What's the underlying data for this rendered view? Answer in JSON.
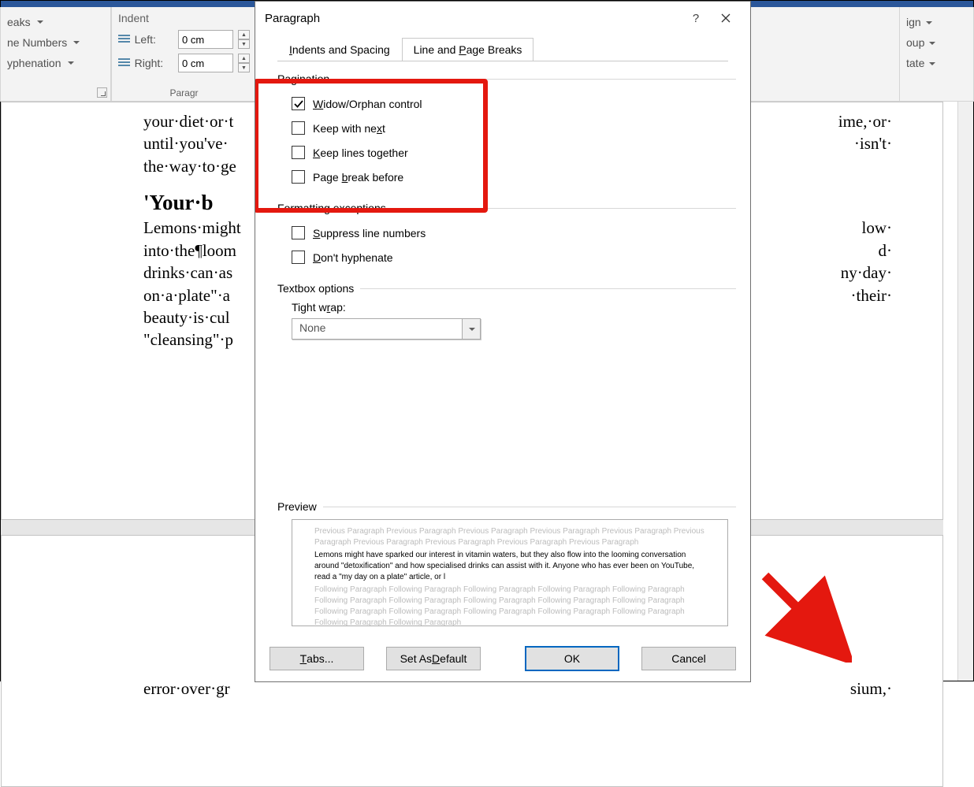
{
  "ribbon": {
    "left": {
      "breaks": "eaks",
      "line_numbers": "ne Numbers",
      "hyphenation": "yphenation"
    },
    "indent": {
      "header": "Indent",
      "left_label": "Left:",
      "right_label": "Right:",
      "left_value": "0 cm",
      "right_value": "0 cm",
      "group_label": "Paragr"
    },
    "right": {
      "align": "ign",
      "group": "oup",
      "rotate": "tate"
    }
  },
  "document": {
    "para1_a": "your·diet·or·t",
    "para1_b": "ime,·or·",
    "para2_a": "until·you've·",
    "para2_b": "·isn't·",
    "para3": "the·way·to·ge",
    "heading": "'Your·b",
    "body1_a": "Lemons·might",
    "body1_b": "low·",
    "body2_a": "into·the¶loom",
    "body2_b": "d·",
    "body3_a": "drinks·can·as",
    "body3_b": "ny·day·",
    "body4_a": "on·a·plate\"·a",
    "body4_b": "·their·",
    "body5": "beauty·is·cul",
    "body6": "\"cleansing\"·p",
    "page2_a": "error·over·gr",
    "page2_b": "sium,·"
  },
  "dialog": {
    "title": "Paragraph",
    "tab1": {
      "pre": "",
      "u": "I",
      "post": "ndents and Spacing"
    },
    "tab2": {
      "pre": "Line and ",
      "u": "P",
      "post": "age Breaks"
    },
    "sec_pagination": "Pagination",
    "chk_widow": {
      "u": "W",
      "post": "idow/Orphan control"
    },
    "chk_keepnext": {
      "pre": "Keep with ne",
      "u": "x",
      "post": "t"
    },
    "chk_keeplines": {
      "u": "K",
      "post": "eep lines together"
    },
    "chk_pbb": {
      "pre": "Page ",
      "u": "b",
      "post": "reak before"
    },
    "sec_format_ex": "Formatting exceptions",
    "chk_suppress": {
      "u": "S",
      "post": "uppress line numbers"
    },
    "chk_donthyph": {
      "u": "D",
      "post": "on't hyphenate"
    },
    "sec_textbox": "Textbox options",
    "tight_wrap": {
      "pre": "Tight w",
      "u": "r",
      "post": "ap:"
    },
    "tight_wrap_value": "None",
    "sec_preview": "Preview",
    "preview_prev": "Previous Paragraph Previous Paragraph Previous Paragraph Previous Paragraph Previous Paragraph Previous Paragraph Previous Paragraph Previous Paragraph Previous Paragraph Previous Paragraph",
    "preview_main": "Lemons might have sparked our interest in vitamin waters, but they also flow into the looming conversation around \"detoxification\" and how specialised drinks can assist with it. Anyone who has ever been on YouTube, read a \"my day on a plate\" article, or l",
    "preview_foll": "Following Paragraph Following Paragraph Following Paragraph Following Paragraph Following Paragraph Following Paragraph Following Paragraph Following Paragraph Following Paragraph Following Paragraph Following Paragraph Following Paragraph Following Paragraph Following Paragraph Following Paragraph Following Paragraph Following Paragraph",
    "btn_tabs": {
      "u": "T",
      "post": "abs..."
    },
    "btn_default": {
      "pre": "Set As ",
      "u": "D",
      "post": "efault"
    },
    "btn_ok": "OK",
    "btn_cancel": "Cancel"
  }
}
